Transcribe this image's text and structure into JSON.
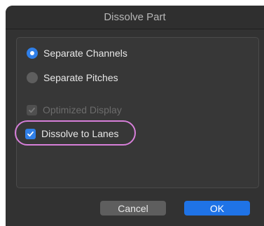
{
  "window": {
    "title": "Dissolve Part"
  },
  "options": {
    "separate_channels": {
      "label": "Separate Channels",
      "selected": true
    },
    "separate_pitches": {
      "label": "Separate Pitches",
      "selected": false
    },
    "optimized_display": {
      "label": "Optimized Display",
      "checked": true,
      "enabled": false
    },
    "dissolve_to_lanes": {
      "label": "Dissolve to Lanes",
      "checked": true,
      "enabled": true
    }
  },
  "buttons": {
    "cancel_label": "Cancel",
    "ok_label": "OK"
  },
  "colors": {
    "accent": "#2f7fe8",
    "highlight_ring": "#d77fd9"
  }
}
